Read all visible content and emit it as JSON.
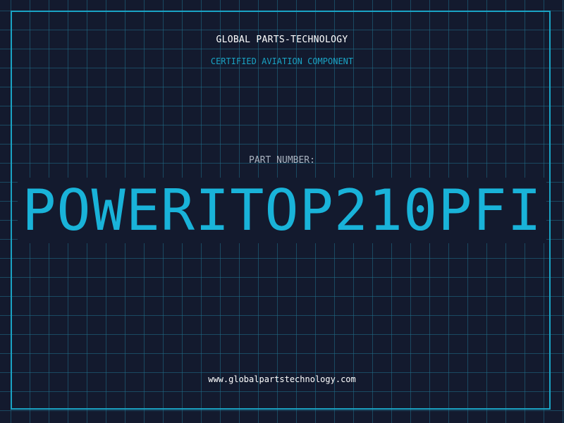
{
  "header": {
    "company": "GLOBAL PARTS-TECHNOLOGY",
    "tagline": "CERTIFIED AVIATION COMPONENT"
  },
  "part": {
    "label": "PART NUMBER:",
    "number": "POWERITOP210PFI"
  },
  "footer": {
    "website": "www.globalpartstechnology.com"
  },
  "colors": {
    "background": "#131a2e",
    "accent": "#1aa3c4",
    "part_number": "#19b3d9",
    "label": "#a9b2bf",
    "text": "#ffffff"
  }
}
